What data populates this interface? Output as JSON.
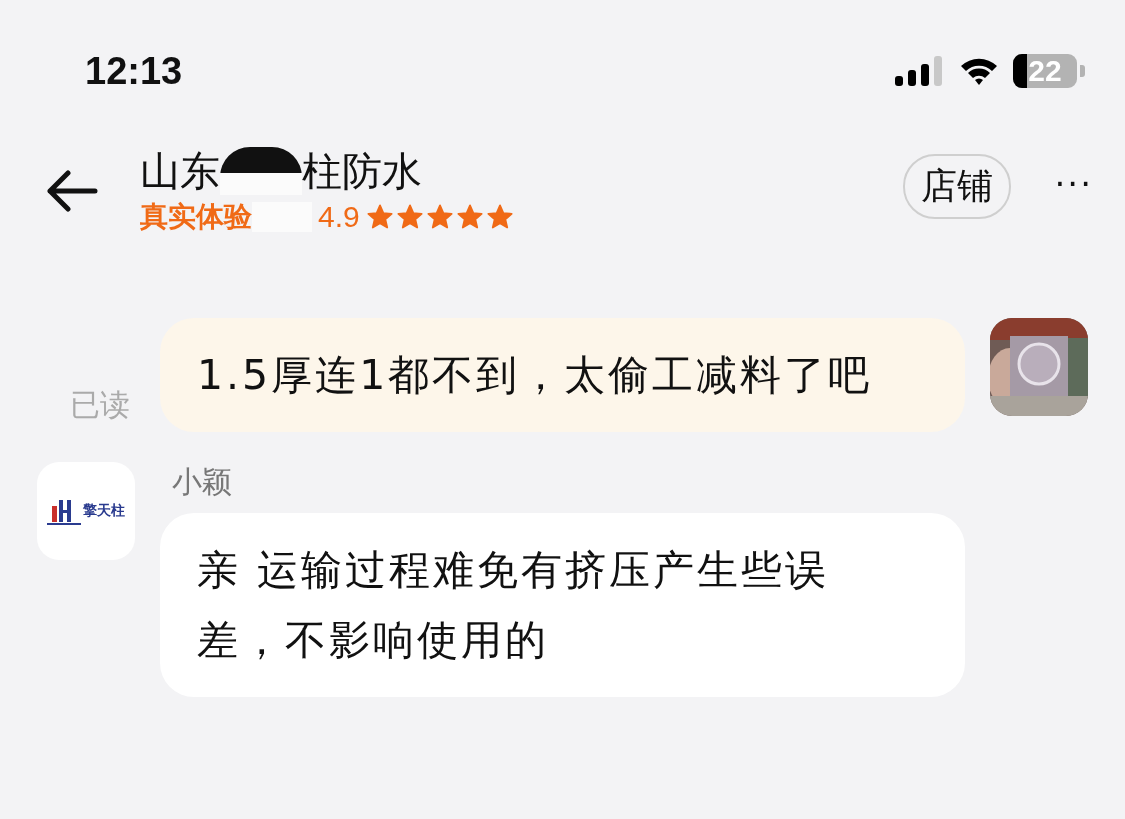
{
  "status_bar": {
    "time": "12:13",
    "battery": "22"
  },
  "header": {
    "title_start": "山东",
    "title_end": "柱防水",
    "tagline": "真实体验",
    "rating": "4.9",
    "stars": 5,
    "shop_button": "店铺",
    "more": "···"
  },
  "messages": [
    {
      "kind": "outgoing",
      "text": "1.5厚连1都不到，太偷工减料了吧",
      "read_receipt": "已读"
    },
    {
      "kind": "incoming",
      "sender": "小颖",
      "logo_text": "擎天柱",
      "text": "亲 运输过程难免有挤压产生些误差，不影响使用的"
    }
  ]
}
